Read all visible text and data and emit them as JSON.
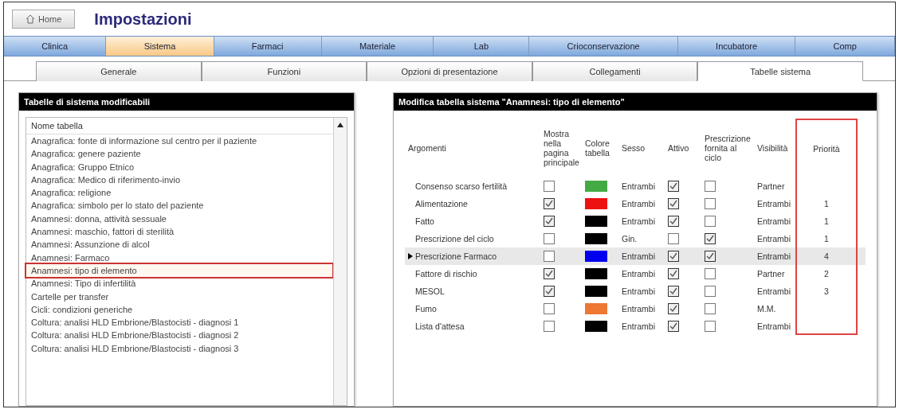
{
  "header": {
    "home_button": "Home",
    "title": "Impostazioni"
  },
  "main_tabs": [
    {
      "label": "Clinica",
      "selected": false
    },
    {
      "label": "Sistema",
      "selected": true
    },
    {
      "label": "Farmaci",
      "selected": false
    },
    {
      "label": "Materiale",
      "selected": false
    },
    {
      "label": "Lab",
      "selected": false
    },
    {
      "label": "Crioconservazione",
      "selected": false
    },
    {
      "label": "Incubatore",
      "selected": false
    },
    {
      "label": "Comp",
      "selected": false
    }
  ],
  "sub_tabs": [
    {
      "label": "Generale",
      "selected": false
    },
    {
      "label": "Funzioni",
      "selected": false
    },
    {
      "label": "Opzioni di presentazione",
      "selected": false
    },
    {
      "label": "Collegamenti",
      "selected": false
    },
    {
      "label": "Tabelle sistema",
      "selected": true
    }
  ],
  "tables_panel": {
    "title": "Tabelle di sistema modificabili",
    "column": "Nome tabella",
    "items": [
      {
        "label": "Anagrafica: fonte di informazione sul centro per il paziente",
        "selected": false
      },
      {
        "label": "Anagrafica: genere paziente",
        "selected": false
      },
      {
        "label": "Anagrafica: Gruppo Etnico",
        "selected": false
      },
      {
        "label": "Anagrafica: Medico di riferimento-invio",
        "selected": false
      },
      {
        "label": "Anagrafica: religione",
        "selected": false
      },
      {
        "label": "Anagrafica: simbolo per lo stato del paziente",
        "selected": false
      },
      {
        "label": "Anamnesi: donna, attività sessuale",
        "selected": false
      },
      {
        "label": "Anamnesi: maschio, fattori di sterilità",
        "selected": false
      },
      {
        "label": "Anamnesi: Assunzione di alcol",
        "selected": false
      },
      {
        "label": "Anamnesi: Farmaco",
        "selected": false
      },
      {
        "label": "Anamnesi: tipo di elemento",
        "selected": true
      },
      {
        "label": "Anamnesi: Tipo di infertilità",
        "selected": false
      },
      {
        "label": "Cartelle per transfer",
        "selected": false
      },
      {
        "label": "Cicli: condizioni generiche",
        "selected": false
      },
      {
        "label": "Coltura: analisi HLD Embrione/Blastocisti - diagnosi 1",
        "selected": false
      },
      {
        "label": "Coltura: analisi HLD Embrione/Blastocisti - diagnosi 2",
        "selected": false
      },
      {
        "label": "Coltura: analisi HLD Embrione/Blastocisti - diagnosi 3",
        "selected": false
      }
    ]
  },
  "edit_panel": {
    "title": "Modifica tabella sistema \"Anamnesi: tipo di elemento\"",
    "columns": [
      "Argomenti",
      "Mostra nella pagina principale",
      "Colore tabella",
      "Sesso",
      "Attivo",
      "Prescrizione fornita al ciclo",
      "Visibilità",
      "Priorità"
    ],
    "rows": [
      {
        "name": "Consenso scarso fertilità",
        "show_main": false,
        "color": "#44aa44",
        "sex": "Entrambi",
        "active": true,
        "prescription": false,
        "visibility": "Partner",
        "priority": "",
        "selected": false
      },
      {
        "name": "Alimentazione",
        "show_main": true,
        "color": "#ee1111",
        "sex": "Entrambi",
        "active": true,
        "prescription": false,
        "visibility": "Entrambi",
        "priority": "1",
        "selected": false
      },
      {
        "name": "Fatto",
        "show_main": true,
        "color": "#000000",
        "sex": "Entrambi",
        "active": true,
        "prescription": false,
        "visibility": "Entrambi",
        "priority": "1",
        "selected": false
      },
      {
        "name": "Prescrizione del ciclo",
        "show_main": false,
        "color": "#000000",
        "sex": "Gin.",
        "active": false,
        "prescription": true,
        "visibility": "Entrambi",
        "priority": "1",
        "selected": false
      },
      {
        "name": "Prescrizione Farmaco",
        "show_main": false,
        "color": "#0000ee",
        "sex": "Entrambi",
        "active": true,
        "prescription": true,
        "visibility": "Entrambi",
        "priority": "4",
        "selected": true
      },
      {
        "name": "Fattore di rischio",
        "show_main": true,
        "color": "#000000",
        "sex": "Entrambi",
        "active": true,
        "prescription": false,
        "visibility": "Partner",
        "priority": "2",
        "selected": false
      },
      {
        "name": "MESOL",
        "show_main": true,
        "color": "#000000",
        "sex": "Entrambi",
        "active": true,
        "prescription": false,
        "visibility": "Entrambi",
        "priority": "3",
        "selected": false
      },
      {
        "name": "Fumo",
        "show_main": false,
        "color": "#ee7733",
        "sex": "Entrambi",
        "active": true,
        "prescription": false,
        "visibility": "M.M.",
        "priority": "",
        "selected": false
      },
      {
        "name": "Lista d'attesa",
        "show_main": false,
        "color": "#000000",
        "sex": "Entrambi",
        "active": true,
        "prescription": false,
        "visibility": "Entrambi",
        "priority": "",
        "selected": false
      }
    ]
  }
}
